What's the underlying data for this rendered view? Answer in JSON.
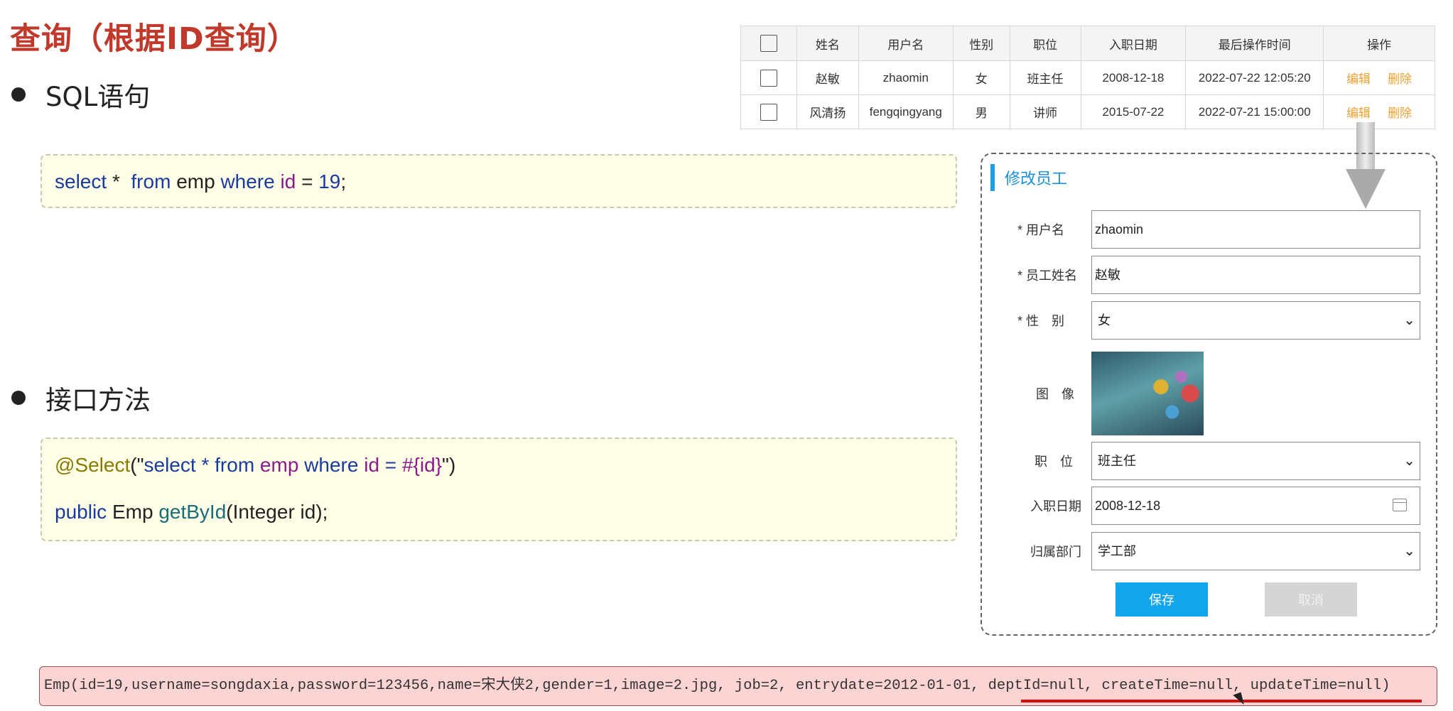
{
  "page_title": "查询（根据ID查询）",
  "sections": [
    {
      "label": "SQL语句"
    },
    {
      "label": "接口方法"
    }
  ],
  "sql": {
    "select": "select",
    "star": "*",
    "from": "from",
    "table": "emp",
    "where": "where",
    "col": "id",
    "eq": "=",
    "value": "19",
    "end": ";"
  },
  "method": {
    "annotation": "@Select",
    "paren_open": "(\"",
    "q_select": "select",
    "q_star": "*",
    "q_from": "from",
    "q_emp": "emp",
    "q_where": "where",
    "q_id": "id",
    "q_eq": "=",
    "q_param": "#{id}",
    "paren_close": "\")",
    "public": "public",
    "ret": "Emp",
    "name": "getById",
    "args": "(Integer id);"
  },
  "table": {
    "headers": [
      "",
      "姓名",
      "用户名",
      "性别",
      "职位",
      "入职日期",
      "最后操作时间",
      "操作"
    ],
    "rows": [
      {
        "name": "赵敏",
        "username": "zhaomin",
        "gender": "女",
        "job": "班主任",
        "entry": "2008-12-18",
        "updated": "2022-07-22 12:05:20",
        "edit": "编辑",
        "delete": "删除"
      },
      {
        "name": "风清扬",
        "username": "fengqingyang",
        "gender": "男",
        "job": "讲师",
        "entry": "2015-07-22",
        "updated": "2022-07-21 15:00:00",
        "edit": "编辑",
        "delete": "删除"
      }
    ]
  },
  "form": {
    "title": "修改员工",
    "username_label": "* 用户名",
    "username_value": "zhaomin",
    "name_label": "* 员工姓名",
    "name_value": "赵敏",
    "gender_label": "* 性　别",
    "gender_value": "女",
    "image_label": "图　像",
    "job_label": "职　位",
    "job_value": "班主任",
    "entry_label": "入职日期",
    "entry_value": "2008-12-18",
    "dept_label": "归属部门",
    "dept_value": "学工部",
    "save": "保存",
    "cancel": "取消"
  },
  "output": "Emp(id=19,username=songdaxia,password=123456,name=宋大侠2,gender=1,image=2.jpg, job=2, entrydate=2012-01-01, deptId=null, createTime=null, updateTime=null)",
  "colors": {
    "title": "#c0392b",
    "accent": "#1aa0e8",
    "action": "#f0a030",
    "highlight": "#d41010"
  }
}
